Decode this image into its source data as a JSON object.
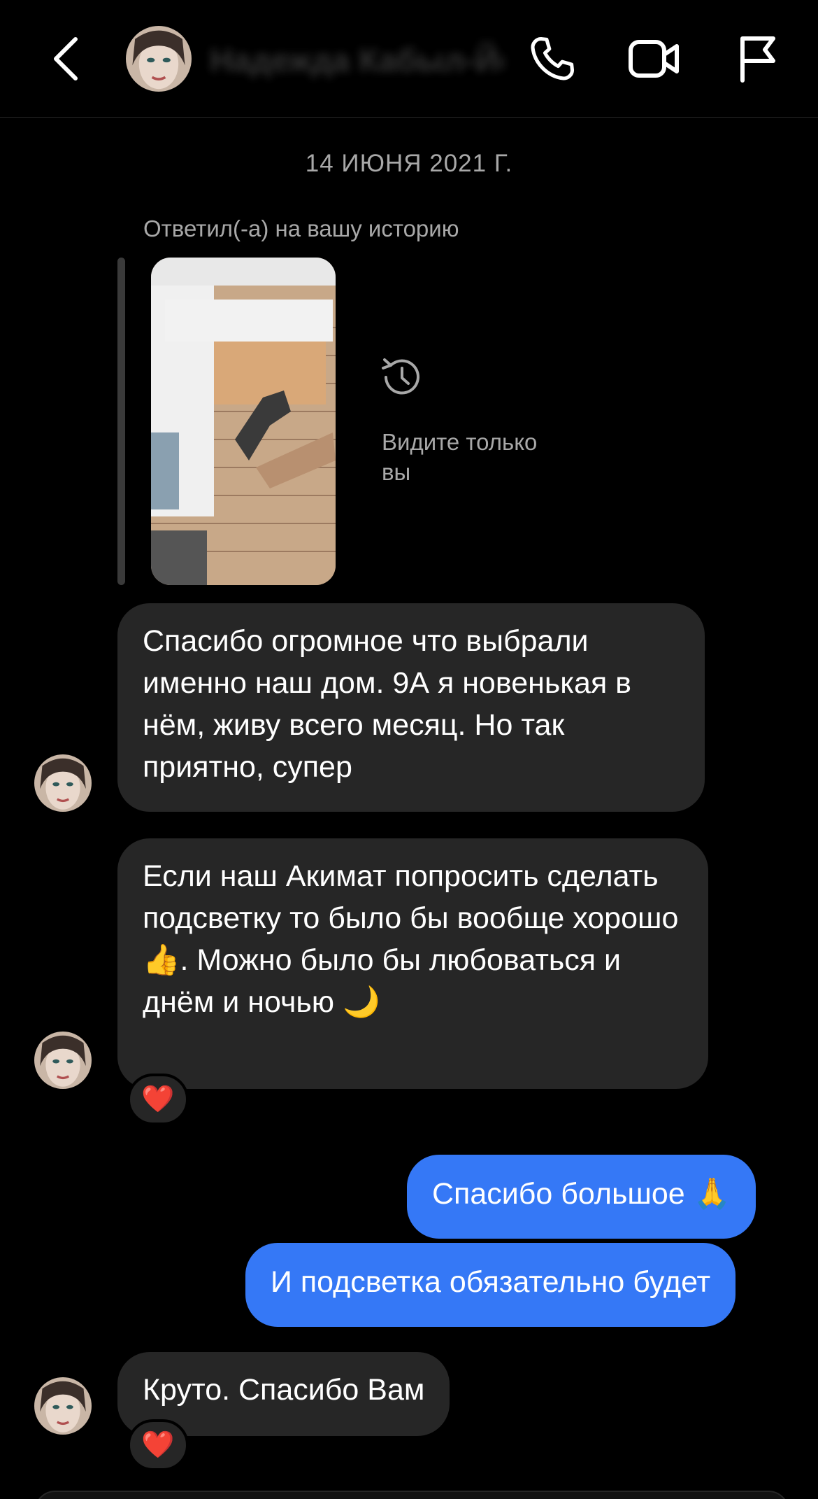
{
  "header": {
    "name": "Надежда Кабыл-Йо",
    "icons": [
      "back-chevron-icon",
      "phone-icon",
      "video-camera-icon",
      "flag-icon"
    ]
  },
  "date_separator": "14 ИЮНЯ 2021 Г.",
  "story_reply": {
    "label": "Ответил(-а) на вашу историю",
    "visibility_note": "Видите только вы",
    "icon": "history-clock-icon"
  },
  "messages": [
    {
      "direction": "in",
      "text": "Спасибо огромное что выбрали именно наш дом. 9А я новенькая в нём, живу всего месяц.  Но так приятно,  супер",
      "reaction": ""
    },
    {
      "direction": "in",
      "text": "Если наш Акимат попросить сделать подсветку то было бы вообще хорошо 👍. Можно было бы любоваться и днём и ночью 🌙",
      "reaction": "❤️"
    },
    {
      "direction": "out",
      "text": "Спасибо большое 🙏",
      "reaction": ""
    },
    {
      "direction": "out",
      "text": "И подсветка обязательно будет",
      "reaction": ""
    },
    {
      "direction": "in",
      "text": "Круто.  Спасибо Вам",
      "reaction": "❤️"
    }
  ],
  "colors": {
    "background": "#000000",
    "incoming_bubble": "#262626",
    "outgoing_bubble": "#3578f6",
    "secondary_text": "#a8a8a8"
  }
}
